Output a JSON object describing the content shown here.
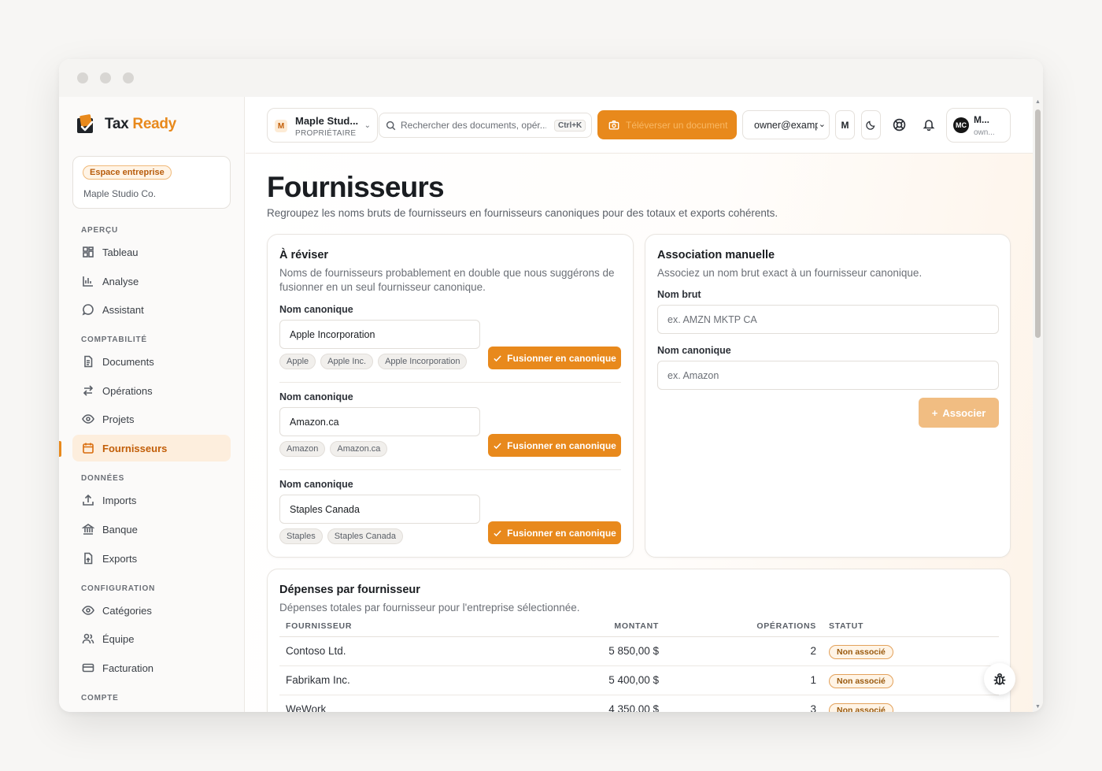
{
  "app": {
    "name_main": "Tax",
    "name_accent": "Ready",
    "colors": {
      "accent": "#e8891c",
      "accent_light": "#fdeedd",
      "text": "#1f2328"
    }
  },
  "sidebar": {
    "enterprise_badge": "Espace entreprise",
    "enterprise_name": "Maple Studio Co.",
    "sections": {
      "apercu": "APERÇU",
      "comptabilite": "COMPTABILITÉ",
      "donnees": "DONNÉES",
      "configuration": "CONFIGURATION",
      "compte": "COMPTE"
    },
    "items": {
      "tableau": "Tableau",
      "analyse": "Analyse",
      "assistant": "Assistant",
      "documents": "Documents",
      "operations": "Opérations",
      "projets": "Projets",
      "fournisseurs": "Fournisseurs",
      "imports": "Imports",
      "banque": "Banque",
      "exports": "Exports",
      "categories": "Catégories",
      "equipe": "Équipe",
      "facturation": "Facturation"
    },
    "active_item": "fournisseurs"
  },
  "topbar": {
    "company_initial": "M",
    "company_name": "Maple Stud...",
    "company_role": "PROPRIÉTAIRE",
    "search_placeholder": "Rechercher des documents, opér...",
    "search_shortcut": "Ctrl+K",
    "upload_label": "Téléverser un document",
    "user_email": "owner@examp",
    "lang_toggle": "M",
    "profile_initials": "MC",
    "profile_name": "M...",
    "profile_role": "own..."
  },
  "page": {
    "title": "Fournisseurs",
    "subtitle": "Regroupez les noms bruts de fournisseurs en fournisseurs canoniques pour des totaux et exports cohérents."
  },
  "review": {
    "title": "À réviser",
    "description": "Noms de fournisseurs probablement en double que nous suggérons de fusionner en un seul fournisseur canonique.",
    "canonical_label": "Nom canonique",
    "merge_label": "Fusionner en canonique",
    "groups": [
      {
        "canonical": "Apple Incorporation",
        "variants": [
          "Apple",
          "Apple Inc.",
          "Apple Incorporation"
        ]
      },
      {
        "canonical": "Amazon.ca",
        "variants": [
          "Amazon",
          "Amazon.ca"
        ]
      },
      {
        "canonical": "Staples Canada",
        "variants": [
          "Staples",
          "Staples Canada"
        ]
      }
    ]
  },
  "manual": {
    "title": "Association manuelle",
    "description": "Associez un nom brut exact à un fournisseur canonique.",
    "raw_label": "Nom brut",
    "raw_placeholder": "ex. AMZN MKTP CA",
    "canonical_label": "Nom canonique",
    "canonical_placeholder": "ex. Amazon",
    "associate_label": "Associer"
  },
  "spend": {
    "title": "Dépenses par fournisseur",
    "description": "Dépenses totales par fournisseur pour l'entreprise sélectionnée.",
    "columns": {
      "vendor": "FOURNISSEUR",
      "amount": "MONTANT",
      "operations": "OPÉRATIONS",
      "status": "STATUT"
    },
    "rows": [
      {
        "vendor": "Contoso Ltd.",
        "amount": "5 850,00 $",
        "operations": "2",
        "status": "Non associé"
      },
      {
        "vendor": "Fabrikam Inc.",
        "amount": "5 400,00 $",
        "operations": "1",
        "status": "Non associé"
      },
      {
        "vendor": "WeWork",
        "amount": "4 350,00 $",
        "operations": "3",
        "status": "Non associé"
      }
    ]
  }
}
